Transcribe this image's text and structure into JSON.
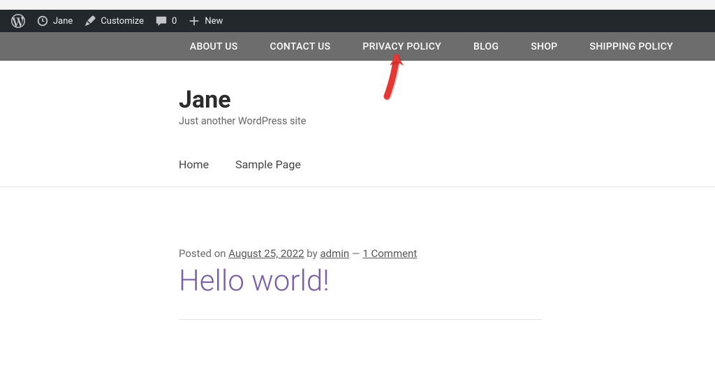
{
  "adminBar": {
    "siteName": "Jane",
    "customize": "Customize",
    "commentsCount": "0",
    "new": "New"
  },
  "mainNav": {
    "items": [
      {
        "label": "ABOUT US"
      },
      {
        "label": "CONTACT US"
      },
      {
        "label": "PRIVACY POLICY"
      },
      {
        "label": "BLOG"
      },
      {
        "label": "SHOP"
      },
      {
        "label": "SHIPPING POLICY"
      }
    ]
  },
  "site": {
    "title": "Jane",
    "tagline": "Just another WordPress site"
  },
  "subNav": {
    "items": [
      {
        "label": "Home"
      },
      {
        "label": "Sample Page"
      }
    ]
  },
  "post": {
    "meta": {
      "postedOn": "Posted on ",
      "date": "August 25, 2022",
      "by": " by ",
      "author": "admin",
      "separator": " — ",
      "comments": "1 Comment"
    },
    "title": "Hello world!"
  }
}
